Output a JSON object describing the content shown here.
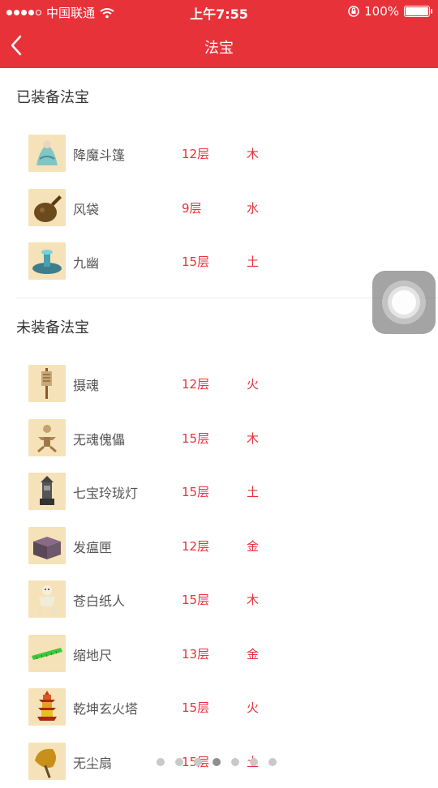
{
  "status_bar": {
    "carrier": "中国联通",
    "time": "上午7:55",
    "battery": "100%"
  },
  "nav": {
    "title": "法宝"
  },
  "equipped": {
    "title": "已装备法宝",
    "items": [
      {
        "name": "降魔斗篷",
        "level": "12层",
        "element": "木",
        "icon": "cloak-figure-icon"
      },
      {
        "name": "风袋",
        "level": "9层",
        "element": "水",
        "icon": "wind-bag-icon"
      },
      {
        "name": "九幽",
        "level": "15层",
        "element": "土",
        "icon": "fountain-icon"
      }
    ]
  },
  "unequipped": {
    "title": "未装备法宝",
    "items": [
      {
        "name": "摄魂",
        "level": "12层",
        "element": "火",
        "icon": "soul-banner-icon"
      },
      {
        "name": "无魂傀儡",
        "level": "15层",
        "element": "木",
        "icon": "puppet-icon"
      },
      {
        "name": "七宝玲珑灯",
        "level": "15层",
        "element": "土",
        "icon": "lantern-icon"
      },
      {
        "name": "发瘟匣",
        "level": "12层",
        "element": "金",
        "icon": "box-icon"
      },
      {
        "name": "苍白纸人",
        "level": "15层",
        "element": "木",
        "icon": "paper-doll-icon"
      },
      {
        "name": "缩地尺",
        "level": "13层",
        "element": "金",
        "icon": "ruler-icon"
      },
      {
        "name": "乾坤玄火塔",
        "level": "15层",
        "element": "火",
        "icon": "pagoda-icon"
      },
      {
        "name": "无尘扇",
        "level": "15层",
        "element": "土",
        "icon": "fan-icon"
      }
    ]
  },
  "pager": {
    "count": 7,
    "active_index": 3
  },
  "colors": {
    "primary": "#e8323a",
    "thumb_bg": "#f6e2b8"
  }
}
